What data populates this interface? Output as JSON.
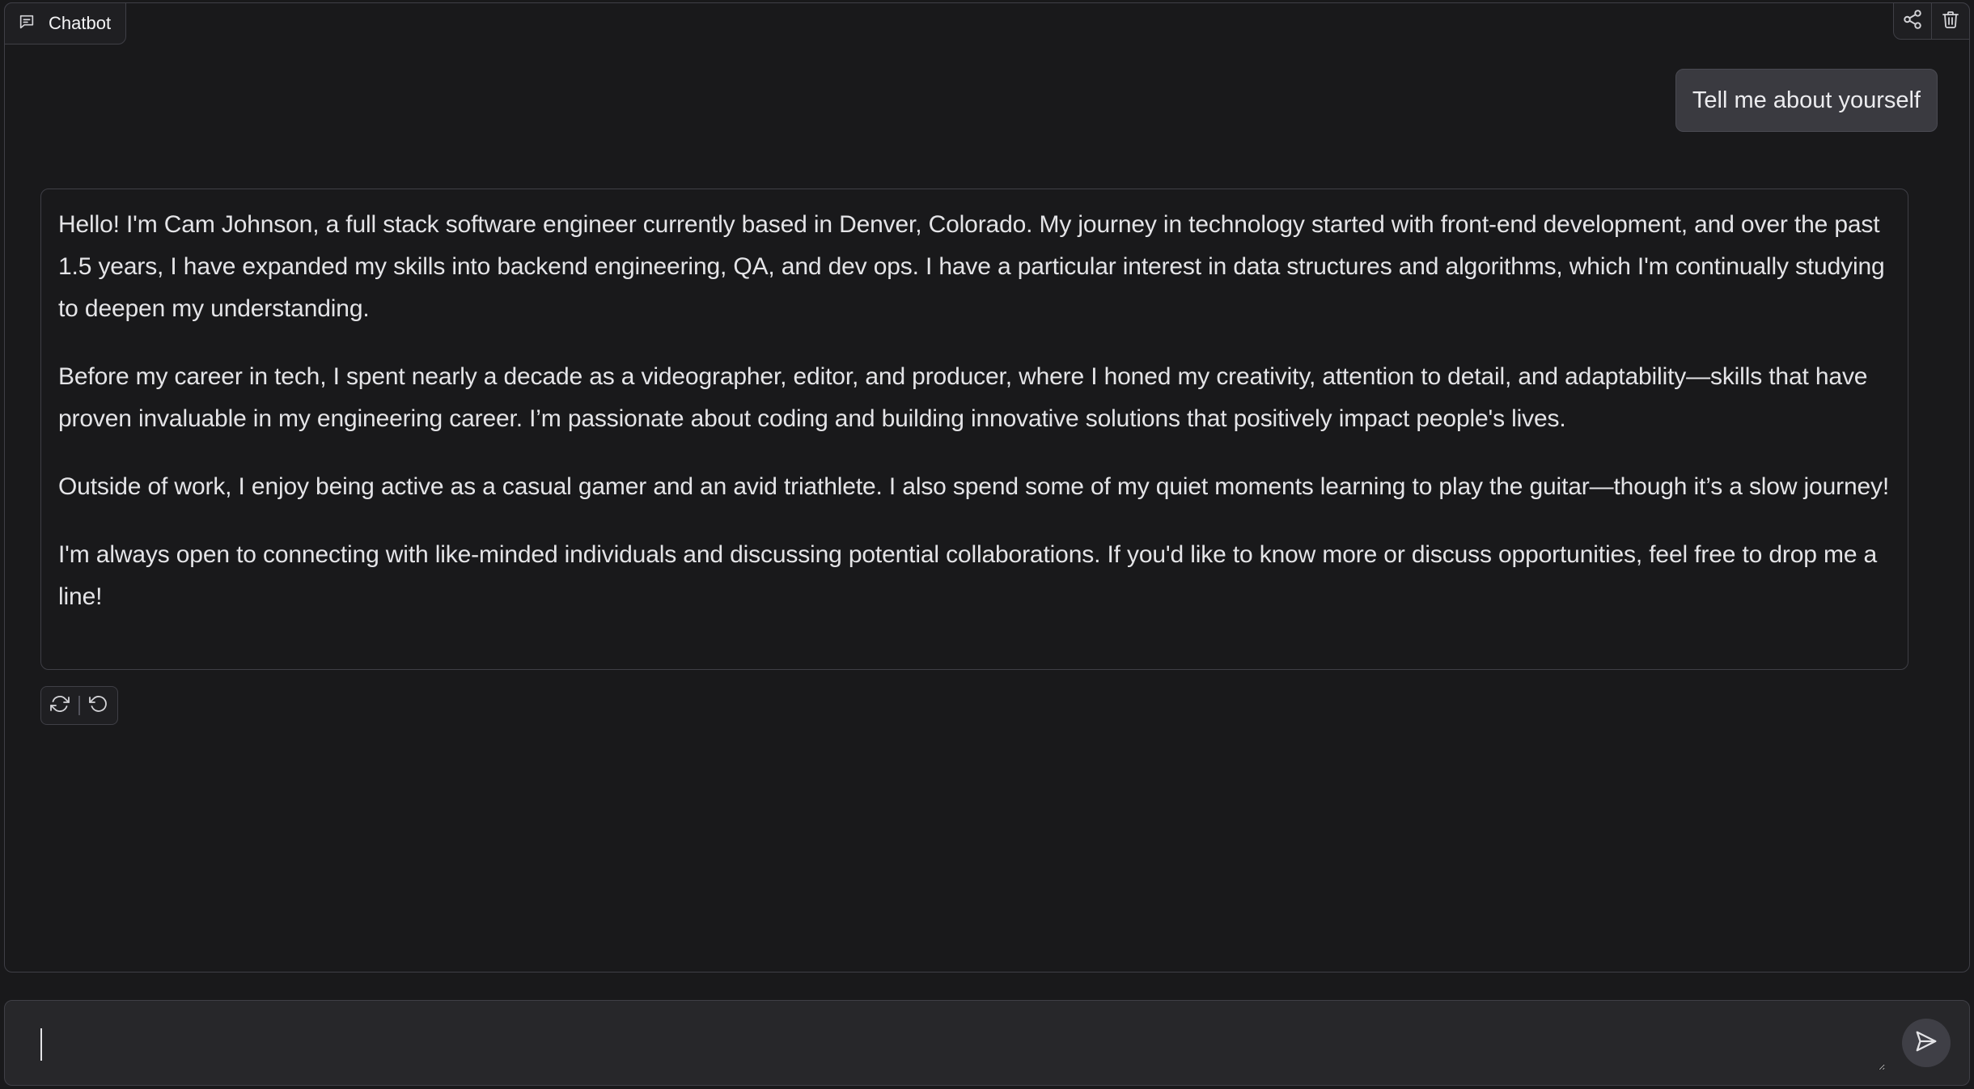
{
  "panel": {
    "label": "Chatbot",
    "label_icon": "chat-icon",
    "actions": [
      {
        "name": "share-icon"
      },
      {
        "name": "trash-icon"
      }
    ]
  },
  "messages": {
    "user": "Tell me about yourself",
    "bot": [
      "Hello! I'm Cam Johnson, a full stack software engineer currently based in Denver, Colorado. My journey in technology started with front-end development, and over the past 1.5 years, I have expanded my skills into backend engineering, QA, and dev ops. I have a particular interest in data structures and algorithms, which I'm continually studying to deepen my understanding.",
      "Before my career in tech, I spent nearly a decade as a videographer, editor, and producer, where I honed my creativity, attention to detail, and adaptability—skills that have proven invaluable in my engineering career. I’m passionate about coding and building innovative solutions that positively impact people's lives.",
      "Outside of work, I enjoy being active as a casual gamer and an avid triathlete. I also spend some of my quiet moments learning to play the guitar—though it’s a slow journey!",
      "I'm always open to connecting with like-minded individuals and discussing potential collaborations. If you'd like to know more or discuss opportunities, feel free to drop me a line!"
    ],
    "bot_actions": [
      {
        "name": "retry-icon"
      },
      {
        "name": "undo-icon"
      }
    ]
  },
  "input": {
    "value": "",
    "placeholder": "",
    "send_icon": "send-icon"
  }
}
